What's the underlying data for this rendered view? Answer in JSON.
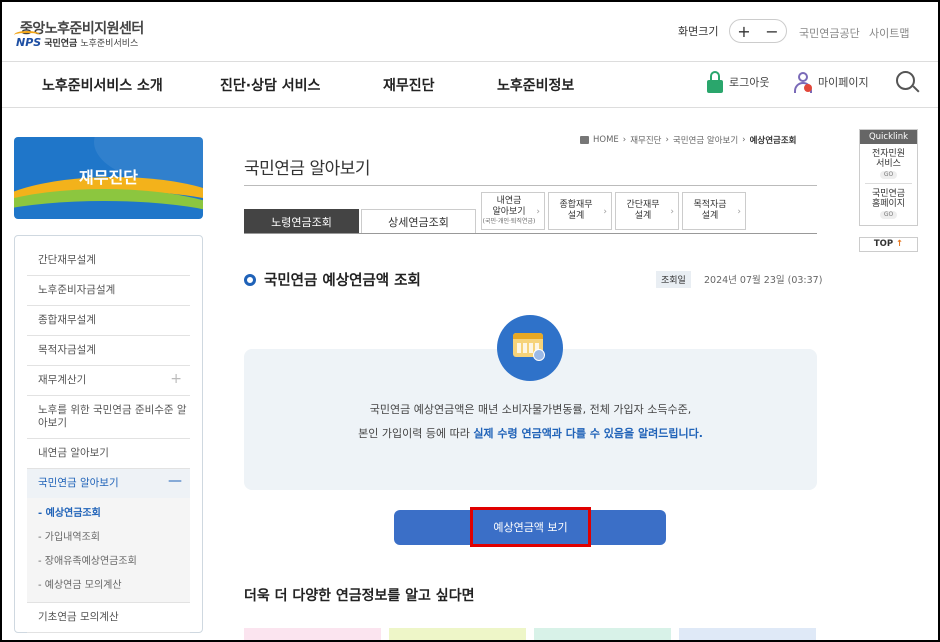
{
  "header": {
    "logo_title": "중앙노후준비지원센터",
    "logo_mark": "NPS",
    "logo_sub_bold": "국민연금",
    "logo_sub": "노후준비서비스",
    "font_size_label": "화면크기",
    "font_plus": "+",
    "font_minus": "−",
    "link_nps": "국민연금공단",
    "link_sitemap": "사이트맵"
  },
  "gnb": {
    "items": [
      "노후준비서비스 소개",
      "진단·상담 서비스",
      "재무진단",
      "노후준비정보"
    ],
    "logout": "로그아웃",
    "mypage": "마이페이지"
  },
  "sidebar": {
    "banner_title": "재무진단",
    "items": [
      {
        "label": "간단재무설계"
      },
      {
        "label": "노후준비자금설계"
      },
      {
        "label": "종합재무설계"
      },
      {
        "label": "목적자금설계"
      },
      {
        "label": "재무계산기",
        "icon": "plus"
      },
      {
        "label": "노후를 위한 국민연금 준비수준 알아보기"
      },
      {
        "label": "내연금 알아보기"
      },
      {
        "label": "국민연금 알아보기",
        "icon": "minus"
      }
    ],
    "sub_items": [
      "- 예상연금조회",
      "- 가입내역조회",
      "- 장애유족예상연금조회",
      "- 예상연금 모의계산"
    ],
    "last_item": "기초연금 모의계산"
  },
  "breadcrumb": [
    "HOME",
    "재무진단",
    "국민연금 알아보기",
    "예상연금조회"
  ],
  "page_title": "국민연금 알아보기",
  "tabs": [
    {
      "label": "노령연금조회",
      "active": true
    },
    {
      "label": "상세연금조회",
      "active": false
    }
  ],
  "subtabs": [
    {
      "line1": "내연금",
      "line2": "알아보기",
      "small": "(국민·개인·퇴직연금)"
    },
    {
      "line1": "종합재무",
      "line2": "설계"
    },
    {
      "line1": "간단재무",
      "line2": "설계"
    },
    {
      "line1": "목적자금",
      "line2": "설계"
    }
  ],
  "section": {
    "title": "국민연금 예상연금액 조회",
    "date_label": "조회일",
    "date_value": "2024년 07월 23일 (03:37)",
    "info_line1": "국민연금 예상연금액은 매년 소비자물가변동률, 전체 가입자 소득수준,",
    "info_line2_pre": "본인 가입이력 등에 따라 ",
    "info_line2_highlight": "실제 수령 연금액과 다를 수 있음을 알려드립니다.",
    "button_label": "예상연금액 보기"
  },
  "more_title": "더욱 더 다양한 연금정보를 알고 싶다면",
  "quicklink": {
    "head": "Quicklink",
    "item1_line1": "전자민원",
    "item1_line2": "서비스",
    "item2_line1": "국민연금",
    "item2_line2": "홈페이지",
    "go": "GO",
    "top_label": "TOP",
    "top_arrow": "↑"
  },
  "colors": {
    "brand_blue": "#1f62b8",
    "button_blue": "#3b6fc7",
    "highlight_red": "#e00000",
    "banner_blue": "#1f76c9"
  },
  "tile_colors": [
    "#fbe4ef",
    "#eef6c8",
    "#d8f2e8",
    "#dfe9f7"
  ]
}
